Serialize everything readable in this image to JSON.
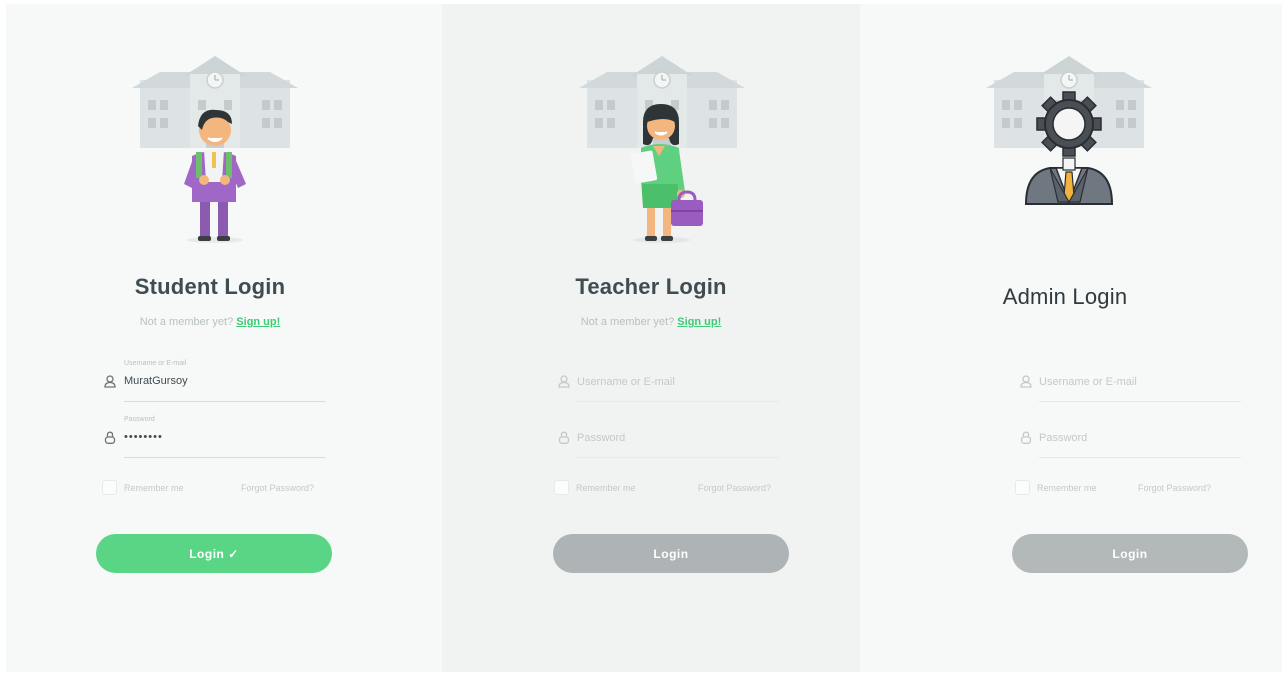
{
  "student": {
    "title": "Student Login",
    "signup_prompt": "Not a member yet?",
    "signup_link": "Sign up!",
    "username_label": "Username or E-mail",
    "username_value": "MuratGursoy",
    "password_label": "Password",
    "password_value": "••••••••",
    "remember_label": "Remember me",
    "forgot_label": "Forgot Password?",
    "login_label": "Login ✓"
  },
  "teacher": {
    "title": "Teacher Login",
    "signup_prompt": "Not a member yet?",
    "signup_link": "Sign up!",
    "username_placeholder": "Username or E-mail",
    "password_placeholder": "Password",
    "remember_label": "Remember me",
    "forgot_label": "Forgot Password?",
    "login_label": "Login"
  },
  "admin": {
    "title": "Admin Login",
    "username_placeholder": "Username or E-mail",
    "password_placeholder": "Password",
    "remember_label": "Remember me",
    "forgot_label": "Forgot Password?",
    "login_label": "Login"
  },
  "colors": {
    "accent_green": "#5ad586",
    "link_green": "#3dcc74",
    "disabled_button": "#aeb4b5"
  },
  "icons": [
    "school-building-icon",
    "student-avatar-icon",
    "teacher-avatar-icon",
    "admin-gear-avatar-icon",
    "user-icon",
    "lock-icon"
  ]
}
